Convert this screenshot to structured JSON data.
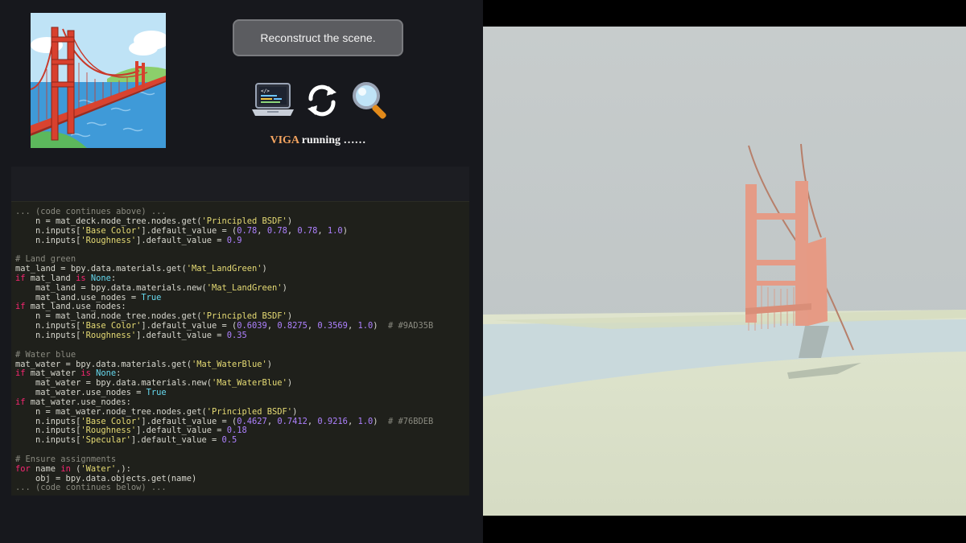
{
  "prompt": {
    "text": "Reconstruct the scene."
  },
  "status": {
    "name": "VIGA",
    "text": " running ……"
  },
  "icons": [
    "laptop-code-icon",
    "refresh-arrows-icon",
    "magnifier-icon"
  ],
  "colors": {
    "status_accent": "#f4a460",
    "land_green": "#9AD35B",
    "water_blue": "#76BDEB",
    "bridge_red": "#e0412f"
  },
  "code": {
    "lines": [
      "... (code continues above) ...",
      "    n = mat_deck.node_tree.nodes.get('Principled BSDF')",
      "    n.inputs['Base Color'].default_value = (0.78, 0.78, 0.78, 1.0)",
      "    n.inputs['Roughness'].default_value = 0.9",
      "",
      "# Land green",
      "mat_land = bpy.data.materials.get('Mat_LandGreen')",
      "if mat_land is None:",
      "    mat_land = bpy.data.materials.new('Mat_LandGreen')",
      "    mat_land.use_nodes = True",
      "if mat_land.use_nodes:",
      "    n = mat_land.node_tree.nodes.get('Principled BSDF')",
      "    n.inputs['Base Color'].default_value = (0.6039, 0.8275, 0.3569, 1.0)  # #9AD35B",
      "    n.inputs['Roughness'].default_value = 0.35",
      "",
      "# Water blue",
      "mat_water = bpy.data.materials.get('Mat_WaterBlue')",
      "if mat_water is None:",
      "    mat_water = bpy.data.materials.new('Mat_WaterBlue')",
      "    mat_water.use_nodes = True",
      "if mat_water.use_nodes:",
      "    n = mat_water.node_tree.nodes.get('Principled BSDF')",
      "    n.inputs['Base Color'].default_value = (0.4627, 0.7412, 0.9216, 1.0)  # #76BDEB",
      "    n.inputs['Roughness'].default_value = 0.18",
      "    n.inputs['Specular'].default_value = 0.5",
      "",
      "# Ensure assignments",
      "for name in ('Water',):",
      "    obj = bpy.data.objects.get(name)",
      "... (code continues below) ..."
    ]
  }
}
